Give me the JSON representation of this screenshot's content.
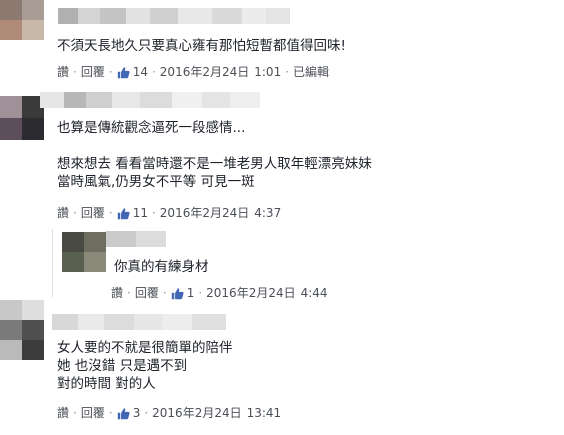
{
  "comments": [
    {
      "text": "不須天長地久只要真心雍有那怕短暫都值得回味!",
      "actions": {
        "like": "讚",
        "reply": "回覆",
        "like_count": "14",
        "date": "2016年2月24日",
        "time": "1:01",
        "edited": "已編輯"
      }
    },
    {
      "text": "也算是傳統觀念逼死一段感情...\n\n想來想去 看看當時還不是一堆老男人取年輕漂亮妹妹\n當時風氣,仍男女不平等 可見一斑",
      "actions": {
        "like": "讚",
        "reply": "回覆",
        "like_count": "11",
        "date": "2016年2月24日",
        "time": "4:37"
      }
    },
    {
      "text": "你真的有練身材",
      "actions": {
        "like": "讚",
        "reply": "回覆",
        "like_count": "1",
        "date": "2016年2月24日",
        "time": "4:44"
      }
    },
    {
      "text": "女人要的不就是很簡單的陪伴\n她 也沒錯 只是遇不到\n對的時間 對的人",
      "actions": {
        "like": "讚",
        "reply": "回覆",
        "like_count": "3",
        "date": "2016年2月24日",
        "time": "13:41"
      }
    }
  ],
  "colors": {
    "action_link": "#4b4f56",
    "meta_gray": "#90949c",
    "like_blue": "#4267b2",
    "text": "#1d2129"
  },
  "icons": {
    "like": "thumbs-up-icon"
  }
}
